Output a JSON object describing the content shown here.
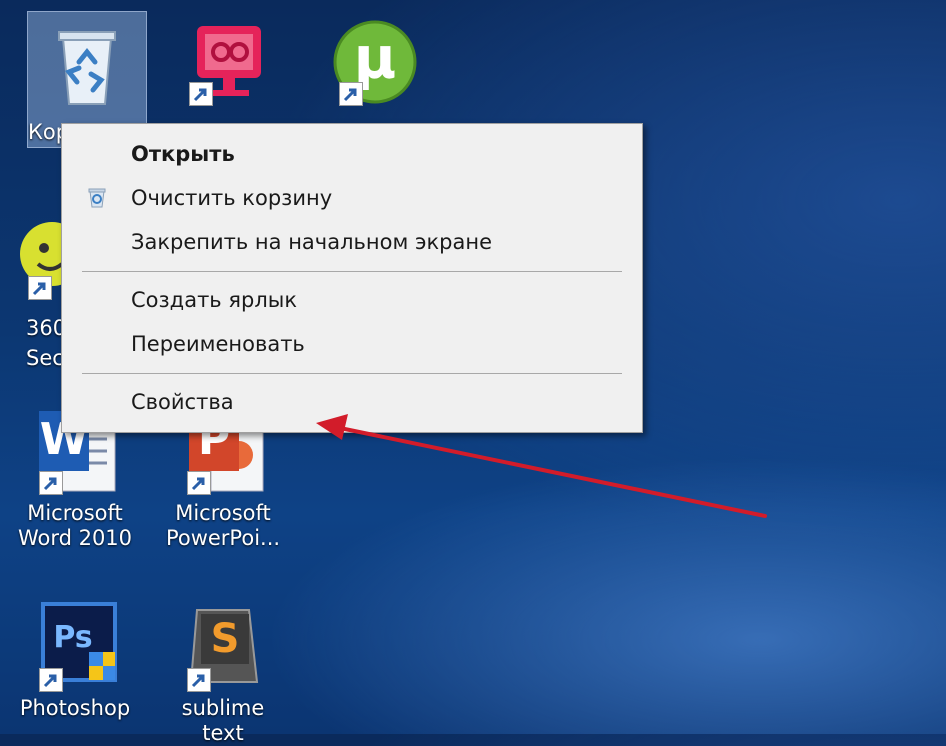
{
  "desktop": {
    "icons": [
      {
        "id": "recycle-bin",
        "label": "Кор"
      },
      {
        "id": "app-red",
        "label": ""
      },
      {
        "id": "utorrent",
        "label": ""
      },
      {
        "id": "360-security",
        "label": "360\nSec"
      },
      {
        "id": "word",
        "label": "Microsoft\nWord 2010"
      },
      {
        "id": "powerpoint",
        "label": "Microsoft\nPowerPoi..."
      },
      {
        "id": "photoshop",
        "label": "Photoshop"
      },
      {
        "id": "sublime",
        "label": "sublime text"
      }
    ],
    "labels": {
      "recycle": "Кор",
      "sec_line1": "360",
      "sec_line2": "Sec",
      "word_line1": "Microsoft",
      "word_line2": "Word 2010",
      "ppt_line1": "Microsoft",
      "ppt_line2": "PowerPoi...",
      "photoshop": "Photoshop",
      "sublime": "sublime text"
    },
    "icon_glyphs": {
      "word": "W",
      "powerpoint": "P",
      "photoshop": "Ps",
      "sublime": "S",
      "utorrent": "µ"
    }
  },
  "context_menu": {
    "items": [
      {
        "label": "Открыть",
        "bold": true
      },
      {
        "label": "Очистить корзину",
        "icon": "recycle-bin-icon"
      },
      {
        "label": "Закрепить на начальном экране"
      },
      {
        "label": "Создать ярлык"
      },
      {
        "label": "Переименовать"
      },
      {
        "label": "Свойства"
      }
    ]
  },
  "colors": {
    "annotation_arrow": "#d21c2a",
    "menu_bg": "#f0f0f0"
  }
}
